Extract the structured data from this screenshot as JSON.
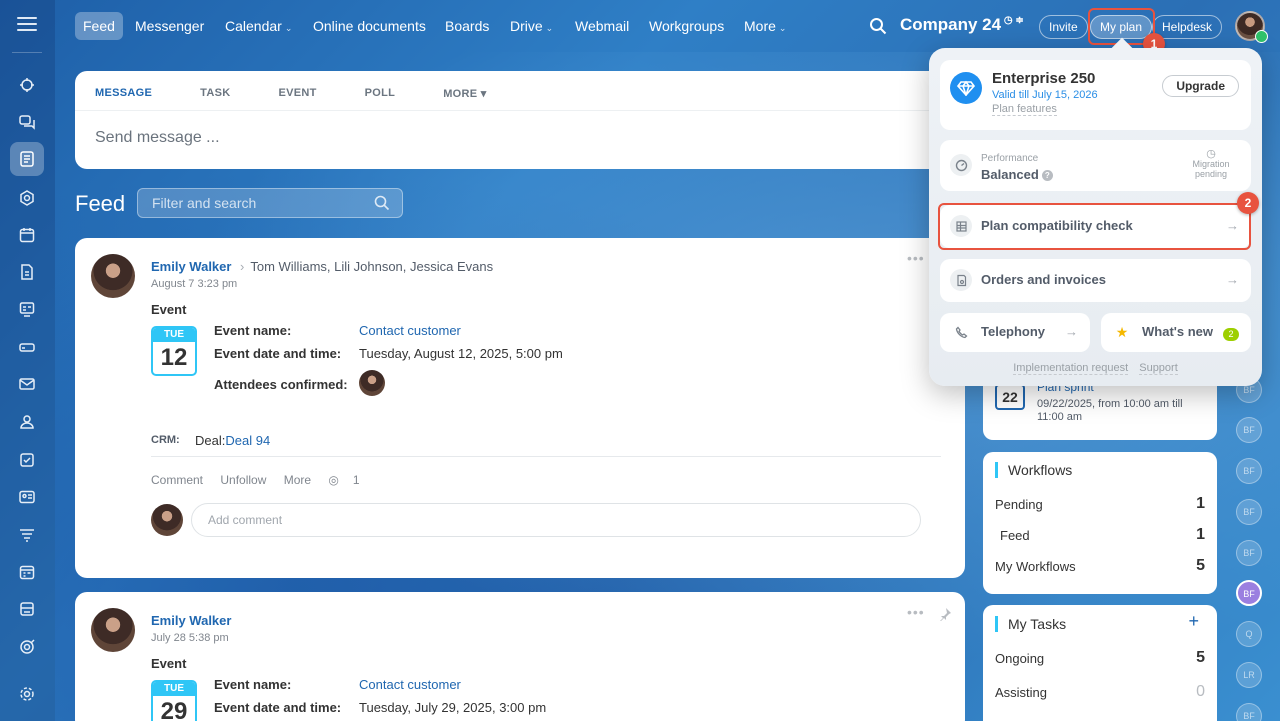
{
  "topnav": {
    "items": [
      {
        "label": "Feed",
        "active": true,
        "caret": false
      },
      {
        "label": "Messenger",
        "caret": false
      },
      {
        "label": "Calendar",
        "caret": true
      },
      {
        "label": "Online documents",
        "caret": false
      },
      {
        "label": "Boards",
        "caret": false
      },
      {
        "label": "Drive",
        "caret": true
      },
      {
        "label": "Webmail",
        "caret": false
      },
      {
        "label": "Workgroups",
        "caret": false
      },
      {
        "label": "More",
        "caret": true
      }
    ],
    "company": "Company 24",
    "invite": "Invite",
    "my_plan": "My plan",
    "helpdesk": "Helpdesk",
    "step1": "1",
    "step2": "2"
  },
  "composer": {
    "tabs": [
      "MESSAGE",
      "TASK",
      "EVENT",
      "POLL",
      "MORE"
    ],
    "placeholder": "Send message ..."
  },
  "feed": {
    "title": "Feed",
    "search_placeholder": "Filter and search"
  },
  "posts": [
    {
      "author": "Emily Walker",
      "recipients": "Tom Williams, Lili Johnson, Jessica Evans",
      "date": "August 7 3:23 pm",
      "type": "Event",
      "cal_month": "TUE",
      "cal_day": "12",
      "event_name_label": "Event name:",
      "event_name": "Contact customer",
      "event_date_label": "Event date and time:",
      "event_date": "Tuesday, August 12, 2025, 5:00 pm",
      "attendees_label": "Attendees confirmed:",
      "crm_label": "CRM:",
      "deal_prefix": "Deal:",
      "deal": "Deal 94",
      "actions": [
        "Comment",
        "Unfollow",
        "More"
      ],
      "views": "1",
      "comment_placeholder": "Add comment"
    },
    {
      "author": "Emily Walker",
      "date": "July 28 5:38 pm",
      "type": "Event",
      "cal_month": "TUE",
      "cal_day": "29",
      "event_name_label": "Event name:",
      "event_name": "Contact customer",
      "event_date_label": "Event date and time:",
      "event_date": "Tuesday, July 29, 2025, 3:00 pm"
    }
  ],
  "plan_popup": {
    "plan_name": "Enterprise 250",
    "valid_till": "Valid till July 15, 2026",
    "plan_features": "Plan features",
    "upgrade": "Upgrade",
    "performance_label": "Performance",
    "performance_value": "Balanced",
    "migration": "Migration pending",
    "compat_check": "Plan compatibility check",
    "orders": "Orders and invoices",
    "telephony": "Telephony",
    "whats_new": "What's new",
    "whats_new_count": "2",
    "impl_request": "Implementation request",
    "support": "Support"
  },
  "event_widget": {
    "day": "22",
    "title": "Plan sprint",
    "time": "09/22/2025, from 10:00 am till 11:00 am"
  },
  "workflows": {
    "title": "Workflows",
    "rows": [
      {
        "label": "Pending",
        "count": "1"
      },
      {
        "label": "Feed",
        "count": "1"
      },
      {
        "label": "My Workflows",
        "count": "5"
      }
    ]
  },
  "tasks": {
    "title": "My Tasks",
    "plus": "+",
    "rows": [
      {
        "label": "Ongoing",
        "count": "5"
      },
      {
        "label": "Assisting",
        "count": "0"
      }
    ]
  },
  "right_rail": [
    "BF",
    "BF",
    "BF",
    "BF",
    "BF",
    "BF",
    "Q",
    "LR",
    "BF"
  ],
  "colors": {
    "accent": "#2067b0",
    "highlight": "#e8533f",
    "cyan": "#2fc6f6"
  }
}
